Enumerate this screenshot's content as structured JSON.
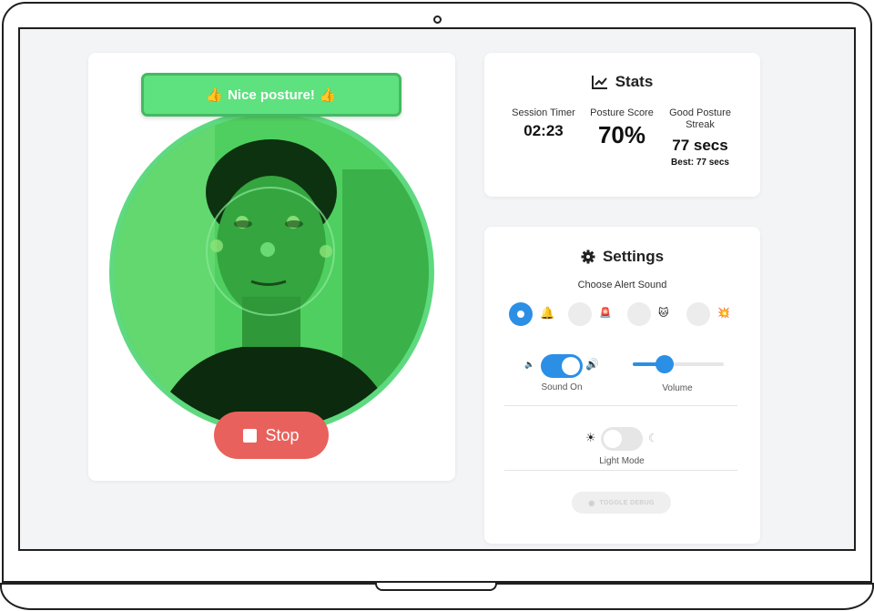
{
  "posture_banner": {
    "text": "Nice posture!",
    "icon_left": "thumbs-up-icon",
    "icon_right": "thumbs-up-icon"
  },
  "controls": {
    "stop_label": "Stop"
  },
  "stats": {
    "title": "Stats",
    "session_timer_label": "Session Timer",
    "session_timer_value": "02:23",
    "posture_score_label": "Posture Score",
    "posture_score_value": "70%",
    "streak_label": "Good Posture Streak",
    "streak_value": "77 secs",
    "streak_best": "Best: 77 secs"
  },
  "settings": {
    "title": "Settings",
    "choose_sound_label": "Choose Alert Sound",
    "sounds": [
      {
        "icon": "bell-icon",
        "glyph": "🔔",
        "selected": true
      },
      {
        "icon": "siren-icon",
        "glyph": "🚨",
        "selected": false
      },
      {
        "icon": "cat-icon",
        "glyph": "🐱",
        "selected": false
      },
      {
        "icon": "explosion-icon",
        "glyph": "💥",
        "selected": false
      }
    ],
    "sound_on_label": "Sound On",
    "sound_on": true,
    "volume_label": "Volume",
    "volume_fraction": 0.35,
    "light_mode_label": "Light Mode",
    "dark_mode": false,
    "debug_label": "TOGGLE DEBUG"
  },
  "colors": {
    "accent": "#2b8fe6",
    "stop": "#e9615c",
    "banner": "#5ee17f",
    "video_tint": "#3fc04f"
  }
}
